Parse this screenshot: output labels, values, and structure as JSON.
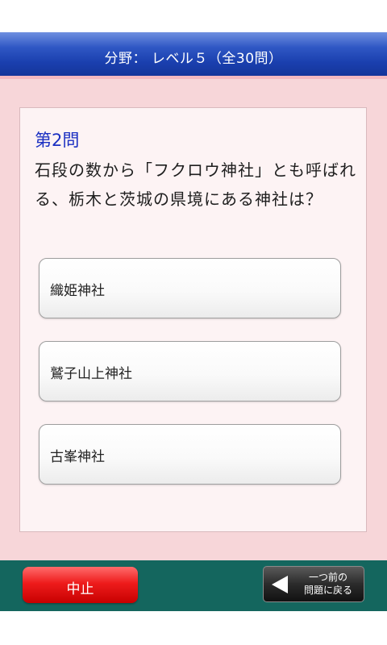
{
  "header": {
    "title": "分野： レベル５（全30問）"
  },
  "question": {
    "number": "第2問",
    "text": "石段の数から「フクロウ神社」とも呼ばれる、栃木と茨城の県境にある神社は？"
  },
  "answers": [
    {
      "label": "織姫神社"
    },
    {
      "label": "鷲子山上神社"
    },
    {
      "label": "古峯神社"
    }
  ],
  "footer": {
    "stop_label": "中止",
    "back_label_line1": "一つ前の",
    "back_label_line2": "問題に戻る",
    "back_icon": "left-triangle-icon"
  },
  "colors": {
    "header": "#1a3fae",
    "background": "#f7d6d9",
    "question_number": "#1a2fc2",
    "stop_button": "#ee1c1c",
    "footer": "#14665e"
  }
}
